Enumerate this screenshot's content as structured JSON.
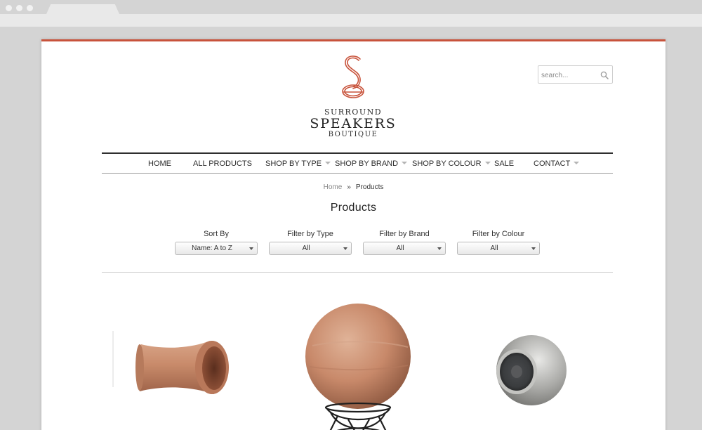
{
  "site": {
    "logo_line1": "SURROUND",
    "logo_line2": "SPEAKERS",
    "logo_line3": "BOUTIQUE",
    "accent_color": "#c8533b"
  },
  "search": {
    "placeholder": "search...",
    "value": "",
    "icon": "search-icon"
  },
  "nav": {
    "items": [
      {
        "label": "HOME",
        "dropdown": false
      },
      {
        "label": "ALL PRODUCTS",
        "dropdown": false
      },
      {
        "label": "SHOP BY TYPE",
        "dropdown": true
      },
      {
        "label": "SHOP BY BRAND",
        "dropdown": true
      },
      {
        "label": "SHOP BY COLOUR",
        "dropdown": true
      },
      {
        "label": "SALE",
        "dropdown": false
      },
      {
        "label": "CONTACT",
        "dropdown": true
      }
    ]
  },
  "breadcrumb": {
    "home": "Home",
    "separator": "»",
    "current": "Products"
  },
  "page_title": "Products",
  "filters": [
    {
      "label": "Sort By",
      "value": "Name: A to Z"
    },
    {
      "label": "Filter by Type",
      "value": "All"
    },
    {
      "label": "Filter by Brand",
      "value": "All"
    },
    {
      "label": "Filter by Colour",
      "value": "All"
    }
  ],
  "products": [
    {
      "image": "terracotta-tube-speaker"
    },
    {
      "image": "terracotta-sphere-speaker-on-stand"
    },
    {
      "image": "silver-sphere-speaker"
    }
  ]
}
